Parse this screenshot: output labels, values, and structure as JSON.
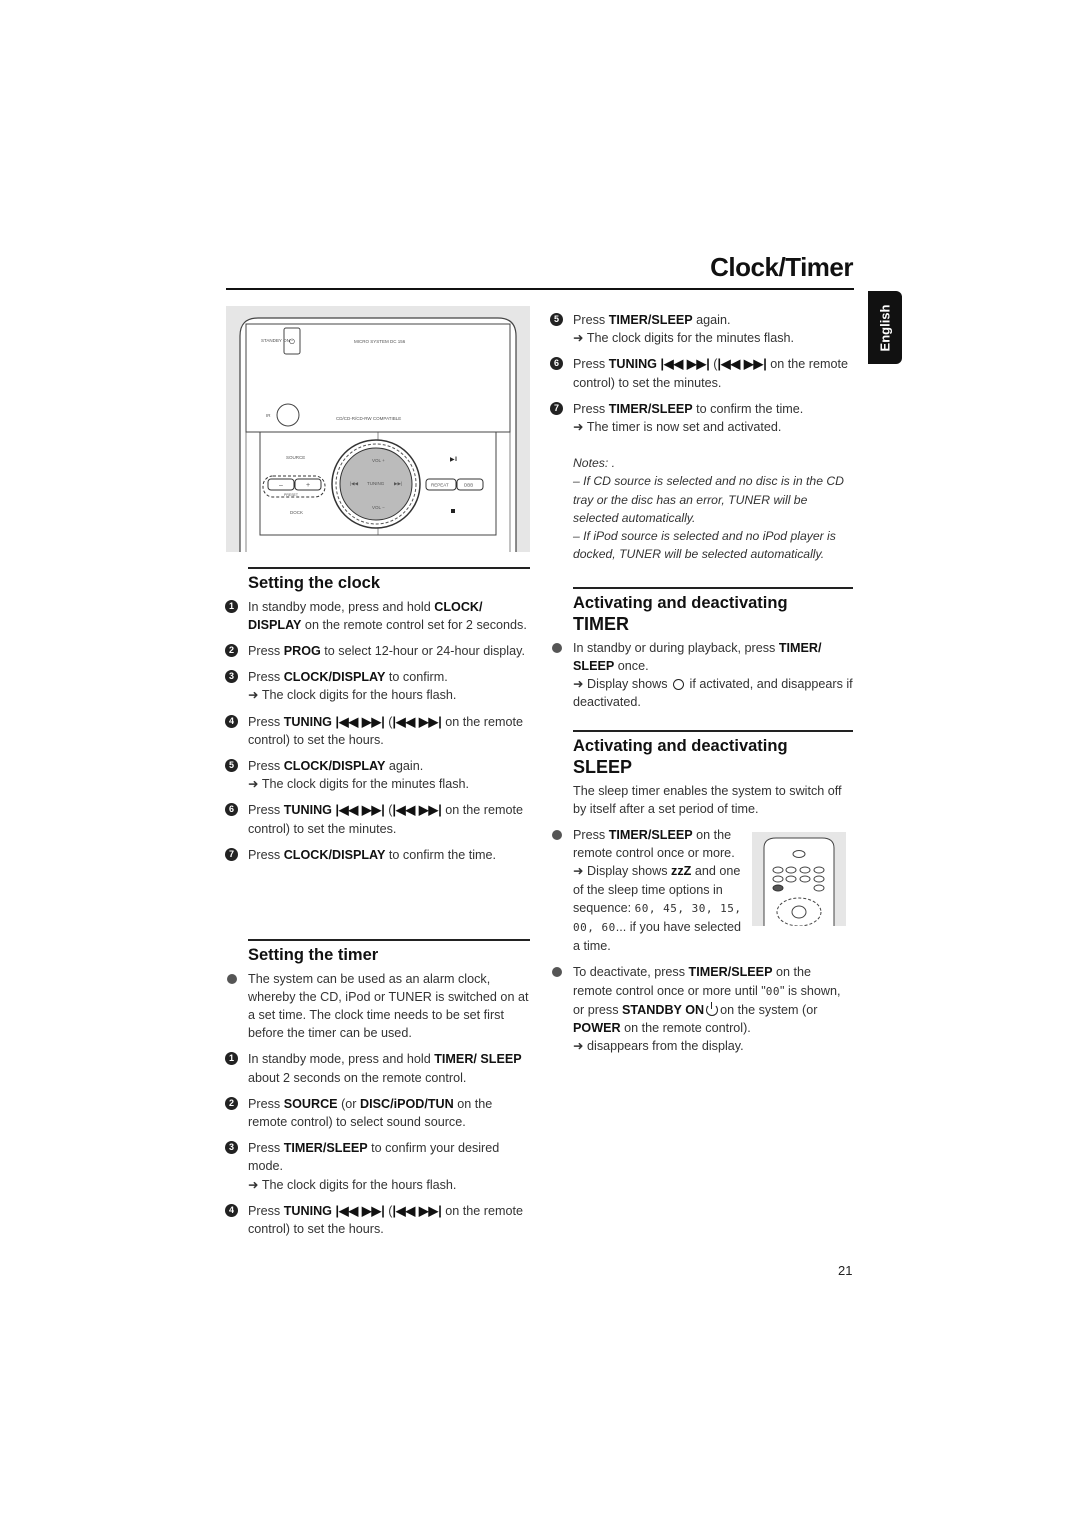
{
  "header": {
    "title": "Clock/Timer",
    "language_tab": "English",
    "page_number": "21"
  },
  "device": {
    "standby": "STANDBY ON",
    "model": "MICRO SYSTEM DC 156",
    "ir": "IR",
    "compat": "CD/CD-R/CD-RW COMPATIBLE",
    "source": "SOURCE",
    "vol_up": "VOL +",
    "vol_down": "VOL −",
    "tuning": "TUNING",
    "repeat": "REPEAT",
    "dbb": "DBB",
    "dock": "DOCK",
    "preset": "PRESET"
  },
  "sections": {
    "setting_clock": {
      "heading": "Setting the clock",
      "steps": [
        {
          "n": "1",
          "p": [
            {
              "t": "In standby mode, press and hold "
            },
            {
              "b": "CLOCK/ DISPLAY"
            },
            {
              "t": " on the remote control set for 2 seconds."
            }
          ]
        },
        {
          "n": "2",
          "p": [
            {
              "t": "Press "
            },
            {
              "b": "PROG"
            },
            {
              "t": " to select 12-hour or 24-hour display."
            }
          ]
        },
        {
          "n": "3",
          "p": [
            {
              "t": "Press "
            },
            {
              "b": "CLOCK/DISPLAY"
            },
            {
              "t": " to confirm."
            }
          ],
          "r": "➜ The clock digits for the hours flash."
        },
        {
          "n": "4",
          "p": [
            {
              "t": "Press "
            },
            {
              "b": "TUNING |◀◀ ▶▶|"
            },
            {
              "t": " ("
            },
            {
              "b": "|◀◀ ▶▶|"
            },
            {
              "t": " on the remote control) to set the hours."
            }
          ]
        },
        {
          "n": "5",
          "p": [
            {
              "t": "Press "
            },
            {
              "b": "CLOCK/DISPLAY"
            },
            {
              "t": " again."
            }
          ],
          "r": "➜ The clock digits for the minutes flash."
        },
        {
          "n": "6",
          "p": [
            {
              "t": "Press "
            },
            {
              "b": "TUNING |◀◀ ▶▶|"
            },
            {
              "t": " ("
            },
            {
              "b": "|◀◀ ▶▶|"
            },
            {
              "t": " on the remote control) to set the minutes."
            }
          ]
        },
        {
          "n": "7",
          "p": [
            {
              "t": "Press "
            },
            {
              "b": "CLOCK/DISPLAY"
            },
            {
              "t": " to confirm the time."
            }
          ]
        }
      ]
    },
    "setting_timer": {
      "heading": "Setting the timer",
      "steps": [
        {
          "n": "",
          "p": [
            {
              "t": "The system can be used as an alarm clock, whereby the CD, iPod or TUNER is switched on at a set time. The clock time needs to be set first before the timer can be used."
            }
          ]
        },
        {
          "n": "1",
          "p": [
            {
              "t": "In standby mode, press and hold "
            },
            {
              "b": "TIMER/ SLEEP"
            },
            {
              "t": " about 2 seconds on the remote control."
            }
          ]
        },
        {
          "n": "2",
          "p": [
            {
              "t": "Press "
            },
            {
              "b": "SOURCE"
            },
            {
              "t": " (or "
            },
            {
              "b": "DISC/iPOD/TUN"
            },
            {
              "t": " on the remote control) to select sound source."
            }
          ]
        },
        {
          "n": "3",
          "p": [
            {
              "t": "Press "
            },
            {
              "b": "TIMER/SLEEP"
            },
            {
              "t": " to confirm your desired mode."
            }
          ],
          "r": "➜ The clock digits for the hours flash."
        },
        {
          "n": "4",
          "p": [
            {
              "t": "Press "
            },
            {
              "b": "TUNING |◀◀ ▶▶|"
            },
            {
              "t": " ("
            },
            {
              "b": "|◀◀ ▶▶|"
            },
            {
              "t": " on the remote control) to set the hours."
            }
          ]
        }
      ]
    },
    "timer_cont": {
      "steps": [
        {
          "n": "5",
          "p": [
            {
              "t": "Press "
            },
            {
              "b": "TIMER/SLEEP"
            },
            {
              "t": " again."
            }
          ],
          "r": "➜ The clock digits for the minutes flash."
        },
        {
          "n": "6",
          "p": [
            {
              "t": "Press "
            },
            {
              "b": "TUNING |◀◀ ▶▶|"
            },
            {
              "t": " ("
            },
            {
              "b": "|◀◀ ▶▶|"
            },
            {
              "t": " on the remote control) to set the minutes."
            }
          ]
        },
        {
          "n": "7",
          "p": [
            {
              "t": "Press "
            },
            {
              "b": "TIMER/SLEEP"
            },
            {
              "t": " to confirm the time."
            }
          ],
          "r": "➜ The timer is now set and activated."
        }
      ],
      "notes_title": "Notes: .",
      "notes": [
        "–  If CD source is selected and no disc is in the CD tray or the disc has an error, TUNER will be selected automatically.",
        "–  If iPod source is selected and no iPod player is docked, TUNER will be selected automatically."
      ]
    },
    "activate_timer": {
      "heading": "Activating and deactivating",
      "heading2": "TIMER",
      "steps": [
        {
          "n": "",
          "p": [
            {
              "t": "In standby or during playback, press "
            },
            {
              "b": "TIMER/ SLEEP"
            },
            {
              "t": " once."
            }
          ],
          "r2": [
            {
              "t": "➜ Display shows "
            },
            {
              "i": "clock-icon"
            },
            {
              "t": " if activated, and disappears if deactivated."
            }
          ]
        }
      ]
    },
    "activate_sleep": {
      "heading": "Activating and deactivating",
      "heading2": "SLEEP",
      "intro": "The sleep timer enables the system to switch off by itself after a set period of time.",
      "steps": [
        {
          "n": "",
          "p": [
            {
              "t": "Press "
            },
            {
              "b": "TIMER/SLEEP"
            },
            {
              "t": " on the remote control once or more."
            }
          ],
          "r2": [
            {
              "t": "➜ Display shows "
            },
            {
              "b": "zzZ"
            },
            {
              "t": " and one of the sleep time options in sequence: "
            },
            {
              "s": "60, 45, 30, 15, 00, 60"
            },
            {
              "t": "... if you have selected a time."
            }
          ],
          "narrow": true
        },
        {
          "n": "",
          "p": [
            {
              "t": "To deactivate, press "
            },
            {
              "b": "TIMER/SLEEP"
            },
            {
              "t": " on the remote control once or more until \""
            },
            {
              "s": "00"
            },
            {
              "t": "\" is shown, or press "
            },
            {
              "b": "STANDBY ON"
            },
            {
              "i": "power-icon"
            },
            {
              "t": "on the system (or "
            },
            {
              "b": "POWER"
            },
            {
              "t": " on the remote control)."
            }
          ],
          "r2": [
            {
              "t": "➜       disappears from the display."
            }
          ]
        }
      ]
    }
  }
}
